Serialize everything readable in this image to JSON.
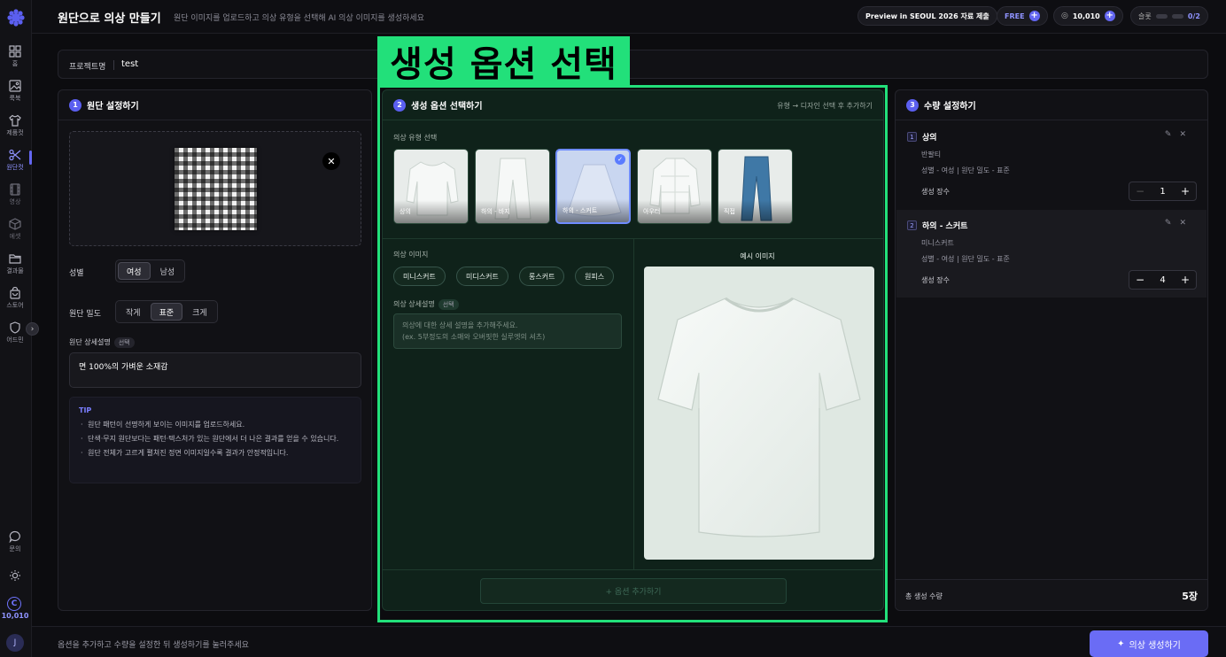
{
  "nav": {
    "items": [
      {
        "label": "홈",
        "icon": "grid-icon"
      },
      {
        "label": "룩북",
        "icon": "image-icon"
      },
      {
        "label": "제품컷",
        "icon": "shirt-icon"
      },
      {
        "label": "원단컷",
        "icon": "scissors-icon"
      },
      {
        "label": "영상",
        "icon": "film-icon"
      },
      {
        "label": "에셋",
        "icon": "cube-icon"
      },
      {
        "label": "결과물",
        "icon": "folder-icon"
      },
      {
        "label": "스토어",
        "icon": "bag-icon"
      },
      {
        "label": "어드민",
        "icon": "shield-icon"
      },
      {
        "label": "문의",
        "icon": "chat-icon"
      }
    ],
    "credit_value": "10,010",
    "avatar_initial": "J"
  },
  "header": {
    "title": "원단으로 의상 만들기",
    "subtitle": "원단 이미지를 업로드하고 의상 유형을 선택해 AI 의상 이미지를 생성하세요",
    "preview_pill": "Preview in SEOUL 2026 자료 제출",
    "plan_pill": "FREE",
    "credits_pill": "10,010",
    "slot_label": "슬롯",
    "slot_value": "0/2"
  },
  "project": {
    "label": "프로젝트명",
    "value": "test"
  },
  "panel1": {
    "step": "1",
    "title": "원단 설정하기",
    "gender_label": "성별",
    "gender_options": [
      "여성",
      "남성"
    ],
    "density_label": "원단 밀도",
    "density_options": [
      "작게",
      "표준",
      "크게"
    ],
    "desc_label": "원단 상세설명",
    "optional_badge": "선택",
    "desc_value": "면 100%의 가벼운 소재감",
    "tip_title": "TIP",
    "tips": [
      "원단 패턴이 선명하게 보이는 이미지를 업로드하세요.",
      "단색·무지 원단보다는 패턴·텍스처가 있는 원단에서 더 나은 결과를 얻을 수 있습니다.",
      "원단 전체가 고르게 펼쳐진 정면 이미지일수록 결과가 안정적입니다."
    ]
  },
  "panel2": {
    "step": "2",
    "title": "생성 옵션 선택하기",
    "hint": "유형 → 디자인 선택 후 추가하기",
    "type_label": "의상 유형 선택",
    "types": [
      "상의",
      "하의 - 바지",
      "하의 - 스커트",
      "아우터",
      "직접"
    ],
    "image_label": "의상 이미지",
    "chips": [
      "미니스커트",
      "미디스커트",
      "롱스커트",
      "원피스"
    ],
    "detail_label": "의상 상세설명",
    "optional_badge": "선택",
    "detail_placeholder_1": "의상에 대한 상세 설명을 추가해주세요.",
    "detail_placeholder_2": "(ex. 5부정도의 소매와 오버핏한 실루엣의 셔츠)",
    "example_title": "예시 이미지",
    "add_button": "+ 옵션 추가하기"
  },
  "annotation": {
    "label": "생성 옵션 선택",
    "color": "#22e07a"
  },
  "panel3": {
    "step": "3",
    "title": "수량 설정하기",
    "items": [
      {
        "num": "1",
        "title": "상의",
        "sub": "반팔티",
        "meta": "성별 - 여성  |  원단 밀도 - 표준",
        "qty_label": "생성 장수",
        "qty": "1"
      },
      {
        "num": "2",
        "title": "하의 - 스커트",
        "sub": "미니스커트",
        "meta": "성별 - 여성  |  원단 밀도 - 표준",
        "qty_label": "생성 장수",
        "qty": "4"
      }
    ],
    "total_label": "총 생성 수량",
    "total_value": "5장"
  },
  "footer": {
    "message": "옵션을 추가하고 수량을 설정한 뒤 생성하기를 눌러주세요",
    "generate_button": "의상 생성하기"
  },
  "colors": {
    "accent": "#6366f1",
    "annotation": "#22e07a",
    "panel2_bg": "#0f221a"
  }
}
